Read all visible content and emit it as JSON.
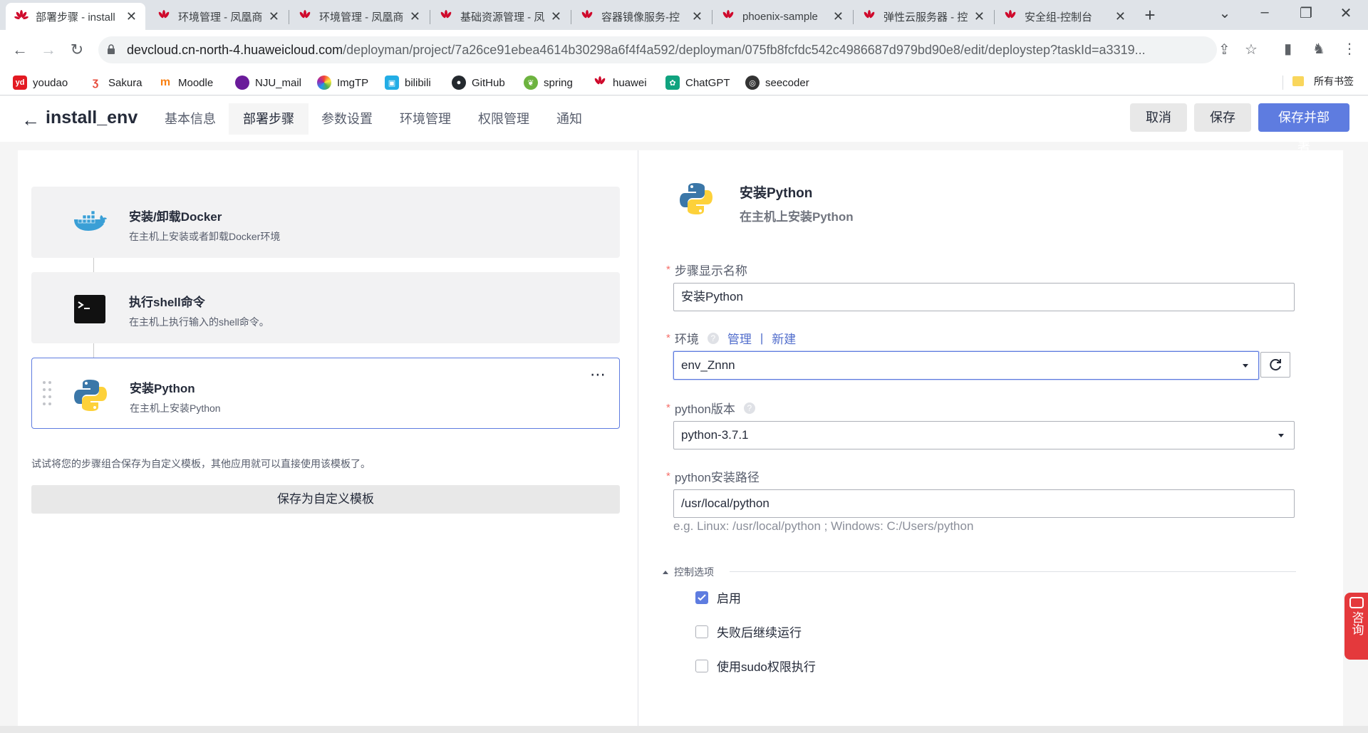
{
  "browser": {
    "tabs": [
      {
        "title": "部署步骤 - install",
        "active": true
      },
      {
        "title": "环境管理 - 凤凰商",
        "active": false
      },
      {
        "title": "环境管理 - 凤凰商",
        "active": false
      },
      {
        "title": "基础资源管理 - 凤",
        "active": false
      },
      {
        "title": "容器镜像服务-控",
        "active": false
      },
      {
        "title": "phoenix-sample",
        "active": false
      },
      {
        "title": "弹性云服务器 - 控",
        "active": false
      },
      {
        "title": "安全组-控制台",
        "active": false
      }
    ],
    "url_host": "devcloud.cn-north-4.huaweicloud.com",
    "url_path": "/deployman/project/7a26ce91ebea4614b30298a6f4f4a592/deployman/075fb8fcfdc542c4986687d979bd90e8/edit/deploystep?taskId=a3319...",
    "bookmarks": [
      {
        "label": "youdao",
        "icon": "youdao-icon",
        "color": "#e31a22",
        "glyph": "yd"
      },
      {
        "label": "Sakura",
        "icon": "sakura-icon",
        "color": "#ffffff",
        "glyph": ""
      },
      {
        "label": "Moodle",
        "icon": "moodle-icon",
        "color": "#ffffff",
        "glyph": ""
      },
      {
        "label": "NJU_mail",
        "icon": "nju-icon",
        "color": "#6a1b9a",
        "glyph": ""
      },
      {
        "label": "ImgTP",
        "icon": "imgtp-icon",
        "color": "#ffffff",
        "glyph": ""
      },
      {
        "label": "bilibili",
        "icon": "bilibili-icon",
        "color": "#23ade5",
        "glyph": ""
      },
      {
        "label": "GitHub",
        "icon": "github-icon",
        "color": "#24292e",
        "glyph": ""
      },
      {
        "label": "spring",
        "icon": "spring-icon",
        "color": "#6db33f",
        "glyph": ""
      },
      {
        "label": "huawei",
        "icon": "huawei-icon",
        "color": "#cf0a2c",
        "glyph": ""
      },
      {
        "label": "ChatGPT",
        "icon": "chatgpt-icon",
        "color": "#10a37f",
        "glyph": ""
      },
      {
        "label": "seecoder",
        "icon": "seecoder-icon",
        "color": "#333333",
        "glyph": ""
      }
    ],
    "all_bookmarks": "所有书签"
  },
  "app": {
    "title": "install_env",
    "nav_tabs": [
      {
        "label": "基本信息",
        "active": false
      },
      {
        "label": "部署步骤",
        "active": true
      },
      {
        "label": "参数设置",
        "active": false
      },
      {
        "label": "环境管理",
        "active": false
      },
      {
        "label": "权限管理",
        "active": false
      },
      {
        "label": "通知",
        "active": false
      }
    ],
    "cancel_label": "取消",
    "save_label": "保存",
    "save_deploy_label": "保存并部署",
    "accent": "#5e7ce0"
  },
  "steps": [
    {
      "name": "安装/卸载Docker",
      "desc": "在主机上安装或者卸载Docker环境",
      "icon": "docker-icon",
      "selected": false
    },
    {
      "name": "执行shell命令",
      "desc": "在主机上执行输入的shell命令。",
      "icon": "terminal-icon",
      "selected": false
    },
    {
      "name": "安装Python",
      "desc": "在主机上安装Python",
      "icon": "python-icon",
      "selected": true
    }
  ],
  "template": {
    "tip": "试试将您的步骤组合保存为自定义模板，其他应用就可以直接使用该模板了。",
    "button": "保存为自定义模板"
  },
  "form": {
    "header_name": "安装Python",
    "header_desc": "在主机上安装Python",
    "step_name_label": "步骤显示名称",
    "step_name_value": "安装Python",
    "env_label": "环境",
    "env_manage": "管理",
    "env_sep": "|",
    "env_new": "新建",
    "env_value": "env_Znnn",
    "python_version_label": "python版本",
    "python_version_value": "python-3.7.1",
    "python_path_label": "python安装路径",
    "python_path_value": "/usr/local/python",
    "python_path_hint": "e.g. Linux: /usr/local/python ; Windows: C:/Users/python",
    "control_label": "控制选项",
    "options": [
      {
        "label": "启用",
        "checked": true
      },
      {
        "label": "失败后继续运行",
        "checked": false
      },
      {
        "label": "使用sudo权限执行",
        "checked": false
      }
    ]
  },
  "consult": {
    "label": "咨询"
  }
}
